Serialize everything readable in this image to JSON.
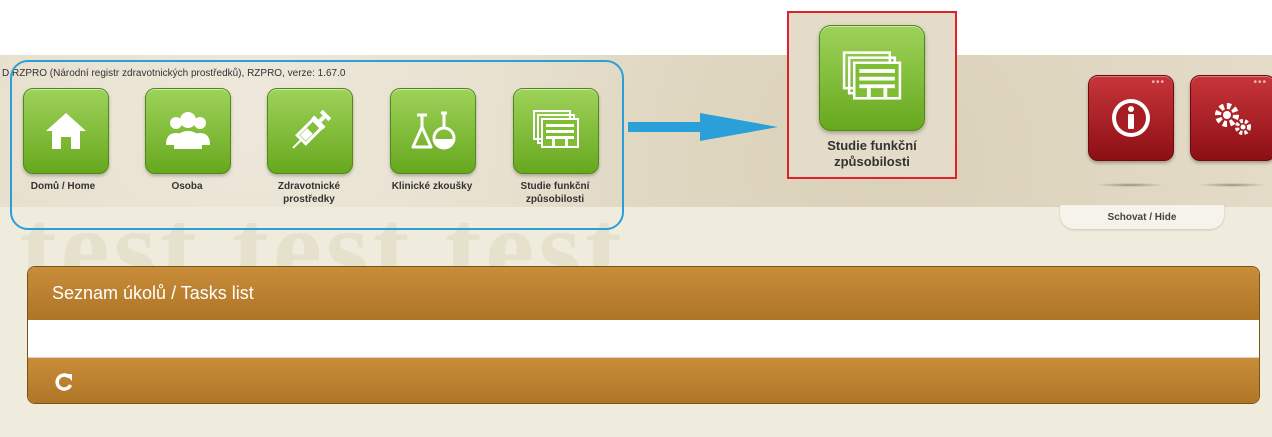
{
  "app": {
    "version_line": "D RZPRO (Národní registr zdravotnických prostředků), RZPRO, verze: 1.67.0",
    "watermark": "test test test"
  },
  "modules": [
    {
      "id": "home",
      "label": "Domů / Home",
      "icon": "home-icon"
    },
    {
      "id": "person",
      "label": "Osoba",
      "icon": "people-icon"
    },
    {
      "id": "devices",
      "label": "Zdravotnické prostředky",
      "icon": "syringe-icon"
    },
    {
      "id": "trials",
      "label": "Klinické zkoušky",
      "icon": "flask-icon"
    },
    {
      "id": "studies",
      "label": "Studie funkční způsobilosti",
      "icon": "documents-icon"
    }
  ],
  "selected_module": {
    "label": "Studie funkční způsobilosti",
    "icon": "documents-icon"
  },
  "right_tiles": [
    {
      "id": "info",
      "icon": "info-icon",
      "dots": "•••"
    },
    {
      "id": "settings",
      "icon": "gears-icon",
      "dots": "•••"
    }
  ],
  "hide_tab": {
    "label": "Schovat / Hide"
  },
  "tasks_panel": {
    "title": "Seznam úkolů / Tasks list",
    "refresh_icon": "refresh-icon"
  },
  "colors": {
    "module_green": "#7fbd33",
    "info_red": "#a81d22",
    "panel_brown": "#bd812f",
    "group_outline": "#2a9fd8",
    "selection_red": "#e0202a"
  }
}
